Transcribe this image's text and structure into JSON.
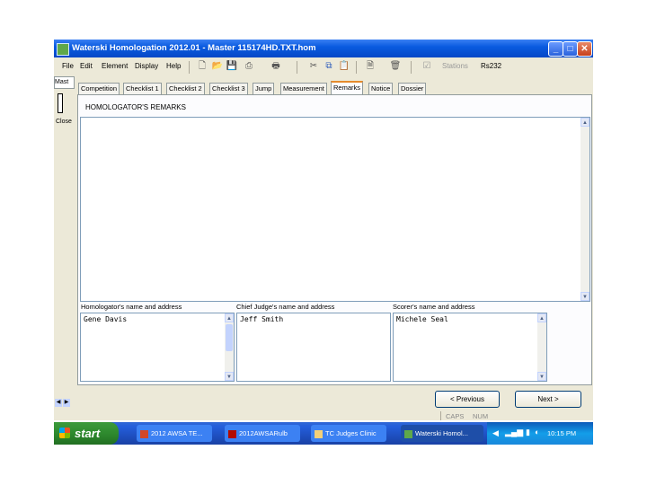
{
  "window": {
    "title": "Waterski Homologation 2012.01 - Master 115174HD.TXT.hom",
    "min": "_",
    "max": "□",
    "close": "✕"
  },
  "menu": [
    "File",
    "Edit",
    "Element",
    "Display",
    "Help"
  ],
  "toolbar": {
    "stations": "Stations",
    "rs232": "Rs232"
  },
  "leftstrip": {
    "top": "Mast",
    "close": "Close"
  },
  "tabs": [
    "Competition",
    "Checklist 1",
    "Checklist 2",
    "Checklist 3",
    "Jump",
    "Measurement",
    "Remarks",
    "Notice",
    "Dossier"
  ],
  "active_tab": "Remarks",
  "remarks": {
    "heading": "HOMOLOGATOR'S REMARKS",
    "value": ""
  },
  "fields": [
    {
      "label": "Homologator's name and address",
      "value": "Gene Davis"
    },
    {
      "label": "Chief Judge's name and address",
      "value": "Jeff Smith"
    },
    {
      "label": "Scorer's name and address",
      "value": "Michele Seal"
    }
  ],
  "buttons": {
    "previous": "< Previous",
    "next": "Next >"
  },
  "status": {
    "caps": "CAPS",
    "num": "NUM"
  },
  "taskbar": {
    "start": "start",
    "tasks": [
      "2012 AWSA TE...",
      "2012AWSARulb",
      "TC Judges Clinic",
      "Waterski Homol..."
    ],
    "clock": "10:15 PM"
  },
  "colors": {
    "titlebar": "#0a5be0",
    "taskbar": "#245edb",
    "start": "#3c9a3c",
    "tab_accent": "#e68b2c"
  }
}
